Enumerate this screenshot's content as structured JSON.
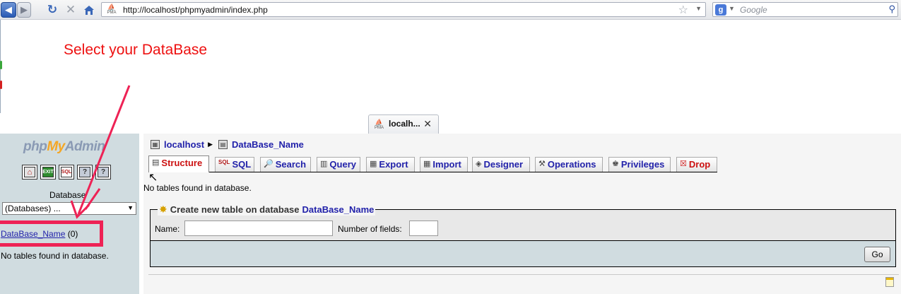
{
  "browser": {
    "url": "http://localhost/phpmyadmin/index.php",
    "search_placeholder": "Google",
    "tab_label": "localh...",
    "favicon_text": "PMA"
  },
  "annotation": {
    "text": "Select your DataBase",
    "color": "#ee1111",
    "highlight_color": "#ee2255"
  },
  "left": {
    "logo_php": "php",
    "logo_my": "My",
    "logo_admin": "Admin",
    "quick_icons": [
      "home-icon",
      "exit-icon",
      "sql-query-icon",
      "query-window-icon",
      "docs-icon"
    ],
    "database_label": "Database",
    "database_select": "(Databases) ...",
    "db_link": "DataBase_Name",
    "db_count": "(0)",
    "no_tables": "No tables found in database."
  },
  "main": {
    "breadcrumb": {
      "server": "localhost",
      "database": "DataBase_Name"
    },
    "tabs": [
      {
        "label": "Structure",
        "icon": "structure-icon",
        "active": true
      },
      {
        "label": "SQL",
        "icon": "sql-icon"
      },
      {
        "label": "Search",
        "icon": "search-icon"
      },
      {
        "label": "Query",
        "icon": "query-icon"
      },
      {
        "label": "Export",
        "icon": "export-icon"
      },
      {
        "label": "Import",
        "icon": "import-icon"
      },
      {
        "label": "Designer",
        "icon": "designer-icon"
      },
      {
        "label": "Operations",
        "icon": "operations-icon"
      },
      {
        "label": "Privileges",
        "icon": "privileges-icon"
      },
      {
        "label": "Drop",
        "icon": "drop-icon"
      }
    ],
    "no_tables": "No tables found in database.",
    "create_table": {
      "legend": "Create new table on database",
      "database": "DataBase_Name",
      "name_label": "Name:",
      "fields_label": "Number of fields:",
      "go_label": "Go"
    }
  }
}
